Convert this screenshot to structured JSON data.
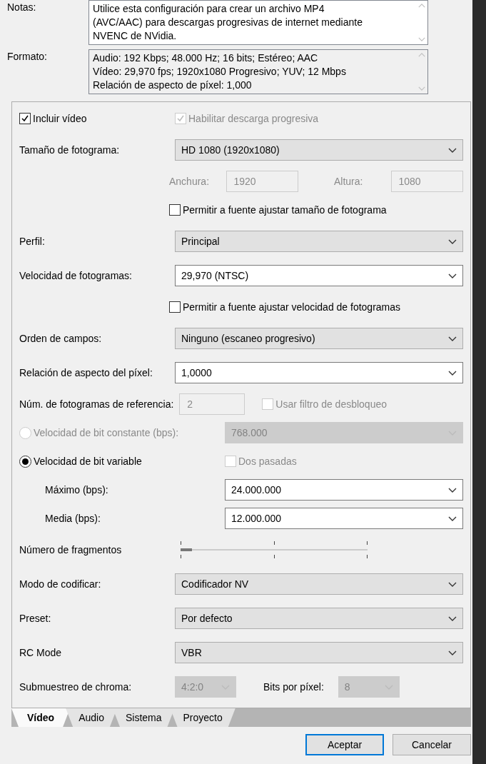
{
  "notes": {
    "label": "Notas:",
    "lines": [
      "Utilice esta configuración para crear un archivo MP4",
      "(AVC/AAC) para descargas progresivas de internet mediante",
      "NVENC de NVidia."
    ]
  },
  "format": {
    "label": "Formato:",
    "lines": [
      "Audio: 192 Kbps; 48.000 Hz; 16 bits; Estéreo; AAC",
      "Vídeo: 29,970 fps; 1920x1080 Progresivo; YUV; 12 Mbps",
      "Relación de aspecto de píxel: 1,000"
    ]
  },
  "rows": [
    {
      "kind": "checkpair",
      "left": {
        "label": "Incluir vídeo",
        "checked": true,
        "disabled": false
      },
      "right": {
        "label": "Habilitar descarga progresiva",
        "checked": true,
        "disabled": true
      }
    },
    {
      "kind": "select",
      "label": "Tamaño de fotograma:",
      "value": "HD 1080 (1920x1080)",
      "editable": false
    },
    {
      "kind": "dims",
      "disabled": true,
      "fields": [
        {
          "label": "Anchura:",
          "value": "1920"
        },
        {
          "label": "Altura:",
          "value": "1080"
        }
      ]
    },
    {
      "kind": "checkbox",
      "label": "Permitir a fuente ajustar tamaño de fotograma",
      "checked": false
    },
    {
      "kind": "select",
      "label": "Perfil:",
      "value": "Principal",
      "editable": false
    },
    {
      "kind": "select",
      "label": "Velocidad de fotogramas:",
      "value": "29,970 (NTSC)",
      "editable": true
    },
    {
      "kind": "checkbox",
      "label": "Permitir a fuente ajustar velocidad de fotogramas",
      "checked": false
    },
    {
      "kind": "select",
      "label": "Orden de campos:",
      "value": "Ninguno (escaneo progresivo)",
      "editable": false
    },
    {
      "kind": "select",
      "label": "Relación de aspecto del píxel:",
      "value": "1,0000",
      "editable": true
    },
    {
      "kind": "spin_check",
      "label": "Núm. de fotogramas de referencia:",
      "value": "2",
      "disabled": true,
      "check": {
        "label": "Usar filtro de desbloqueo",
        "checked": false,
        "disabled": true
      }
    },
    {
      "kind": "radio_select",
      "label": "Velocidad de bit constante (bps):",
      "selected": false,
      "disabled": true,
      "value": "768.000"
    },
    {
      "kind": "radio_check",
      "label": "Velocidad de bit variable",
      "selected": true,
      "disabled": false,
      "check": {
        "label": "Dos pasadas",
        "checked": false,
        "disabled": true
      }
    },
    {
      "kind": "sub_select",
      "label": "Máximo (bps):",
      "value": "24.000.000",
      "editable": true
    },
    {
      "kind": "sub_select",
      "label": "Media (bps):",
      "value": "12.000.000",
      "editable": true
    },
    {
      "kind": "slider",
      "label": "Número de fragmentos",
      "level": 0.06
    },
    {
      "kind": "select",
      "label": "Modo de codificar:",
      "value": "Codificador NV",
      "editable": false
    },
    {
      "kind": "select",
      "label": "Preset:",
      "value": "Por defecto",
      "editable": false
    },
    {
      "kind": "select",
      "label": "RC Mode",
      "value": "VBR",
      "editable": false
    },
    {
      "kind": "dual_select",
      "disabled": true,
      "items": [
        {
          "label": "Submuestreo de chroma:",
          "value": "4:2:0"
        },
        {
          "label": "Bits por píxel:",
          "value": "8"
        }
      ]
    }
  ],
  "tabs": [
    {
      "label": "Vídeo",
      "selected": true
    },
    {
      "label": "Audio",
      "selected": false
    },
    {
      "label": "Sistema",
      "selected": false
    },
    {
      "label": "Proyecto",
      "selected": false
    }
  ],
  "buttons": [
    {
      "label": "Aceptar",
      "default": true
    },
    {
      "label": "Cancelar",
      "default": false
    }
  ]
}
